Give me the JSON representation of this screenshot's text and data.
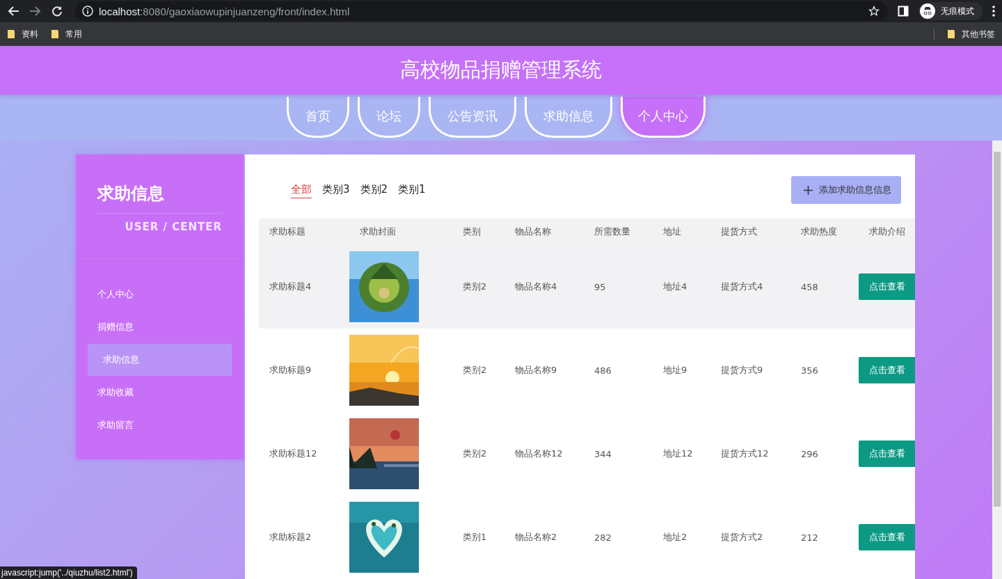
{
  "browser": {
    "url_host": "localhost",
    "url_rest": ":8080/gaoxiaowupinjuanzeng/front/index.html",
    "profile": "无痕模式",
    "bookmarks": [
      "资料",
      "常用"
    ],
    "other_bookmarks": "其他书签"
  },
  "header": {
    "title": "高校物品捐赠管理系统"
  },
  "nav": [
    {
      "label": "首页",
      "selected": false
    },
    {
      "label": "论坛",
      "selected": false
    },
    {
      "label": "公告资讯",
      "selected": false
    },
    {
      "label": "求助信息",
      "selected": false
    },
    {
      "label": "个人中心",
      "selected": true
    }
  ],
  "sidebar": {
    "title": "求助信息",
    "subtitle": "USER / CENTER",
    "items": [
      {
        "label": "个人中心",
        "selected": false
      },
      {
        "label": "捐赠信息",
        "selected": false
      },
      {
        "label": "求助信息",
        "selected": true
      },
      {
        "label": "求助收藏",
        "selected": false
      },
      {
        "label": "求助留言",
        "selected": false
      }
    ]
  },
  "filters": [
    {
      "label": "全部",
      "selected": true
    },
    {
      "label": "类别3",
      "selected": false
    },
    {
      "label": "类别2",
      "selected": false
    },
    {
      "label": "类别1",
      "selected": false
    }
  ],
  "add_button": "添加求助信息信息",
  "table": {
    "columns": [
      "求助标题",
      "求助封面",
      "类别",
      "物品名称",
      "所需数量",
      "地址",
      "提货方式",
      "求助热度",
      "求助介绍"
    ],
    "rows": [
      {
        "title": "求助标题4",
        "category": "类别2",
        "item": "物品名称4",
        "quantity": "95",
        "address": "地址4",
        "pickup": "提货方式4",
        "heat": "458",
        "action": "点击查看",
        "highlighted": true
      },
      {
        "title": "求助标题9",
        "category": "类别2",
        "item": "物品名称9",
        "quantity": "486",
        "address": "地址9",
        "pickup": "提货方式9",
        "heat": "356",
        "action": "点击查看",
        "highlighted": false
      },
      {
        "title": "求助标题12",
        "category": "类别2",
        "item": "物品名称12",
        "quantity": "344",
        "address": "地址12",
        "pickup": "提货方式12",
        "heat": "296",
        "action": "点击查看",
        "highlighted": false
      },
      {
        "title": "求助标题2",
        "category": "类别1",
        "item": "物品名称2",
        "quantity": "282",
        "address": "地址2",
        "pickup": "提货方式2",
        "heat": "212",
        "action": "点击查看",
        "highlighted": false
      }
    ]
  },
  "status_link": "javascript:jump('../qiuzhu/list2.html')"
}
